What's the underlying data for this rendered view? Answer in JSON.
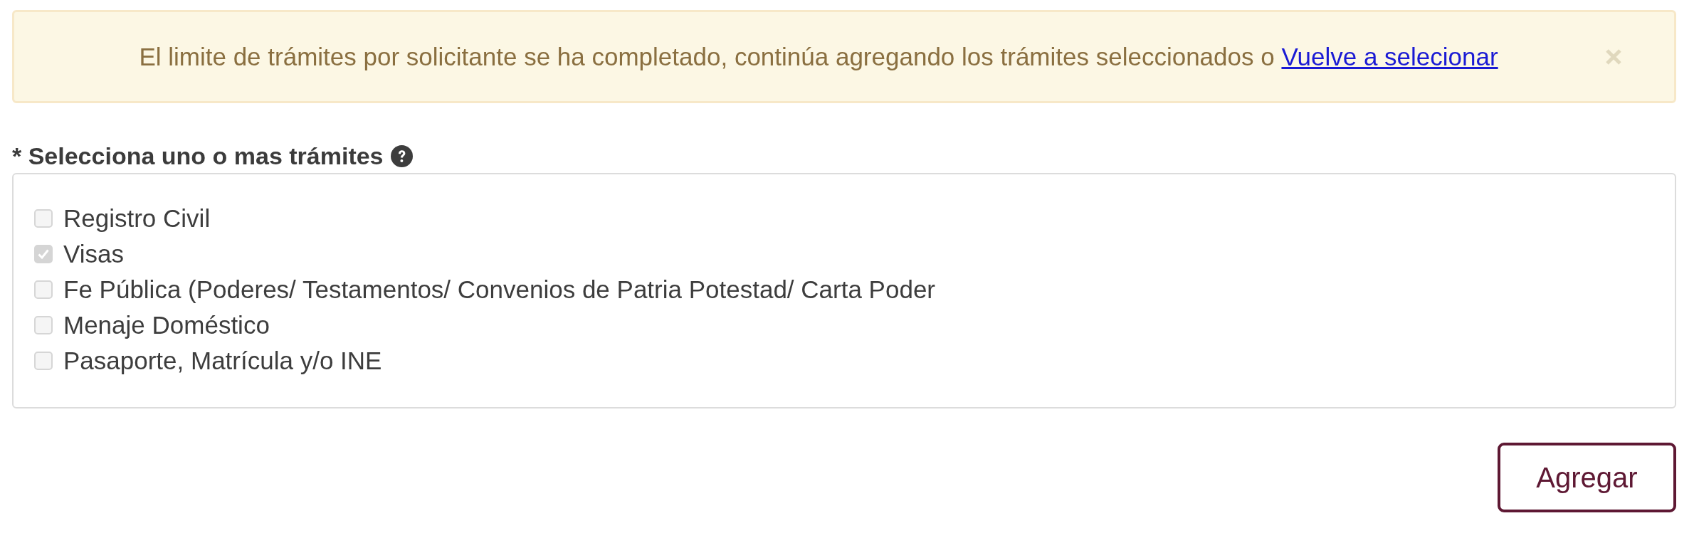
{
  "alert": {
    "message": "El limite de trámites por solicitante se ha completado, continúa agregando los trámites seleccionados o",
    "link": "Vuelve a selecionar"
  },
  "field": {
    "label": "* Selecciona uno o mas trámites",
    "options": [
      {
        "label": "Registro Civil",
        "checked": false,
        "disabled": true
      },
      {
        "label": "Visas",
        "checked": true,
        "disabled": true
      },
      {
        "label": "Fe Pública (Poderes/ Testamentos/ Convenios de Patria Potestad/ Carta Poder",
        "checked": false,
        "disabled": true
      },
      {
        "label": "Menaje Doméstico",
        "checked": false,
        "disabled": true
      },
      {
        "label": "Pasaporte, Matrícula y/o INE",
        "checked": false,
        "disabled": true
      }
    ]
  },
  "add_button": {
    "label": "Agregar"
  }
}
